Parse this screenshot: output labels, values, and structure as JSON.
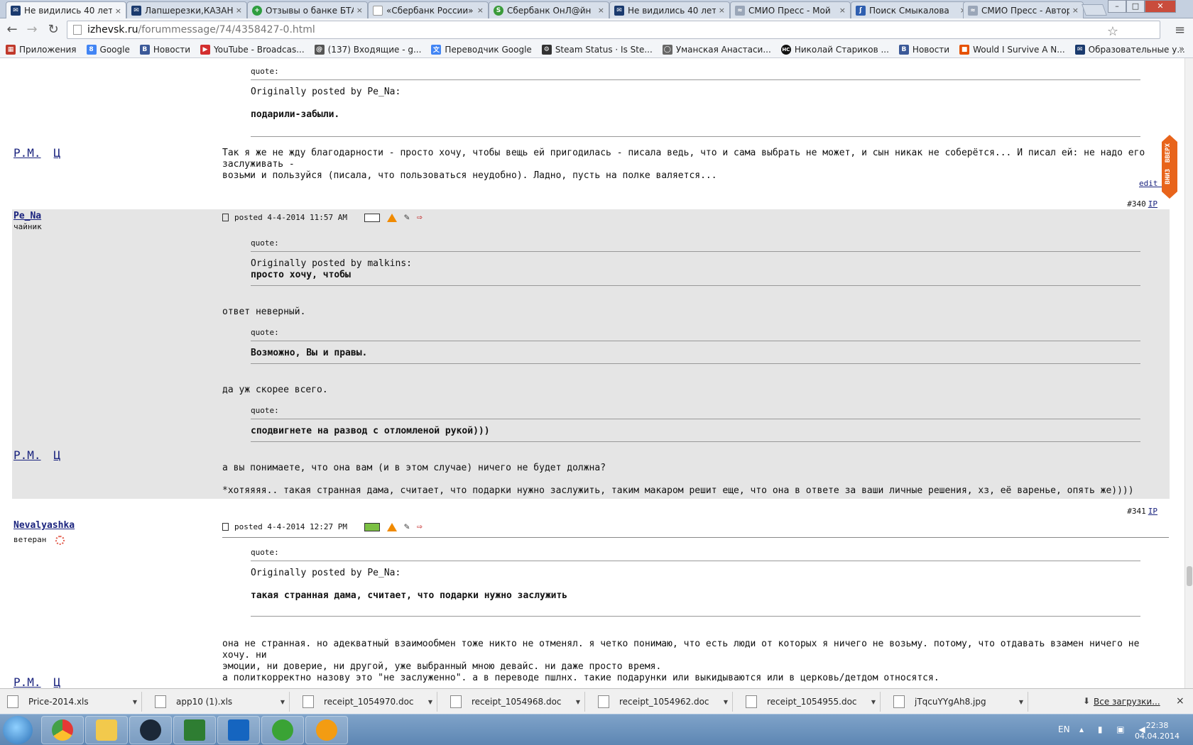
{
  "browser": {
    "tabs": [
      {
        "title": "Не видились 40 лет...",
        "color": "#1a3a6e",
        "fav": "✉"
      },
      {
        "title": "Лапшерезки,КАЗАНЬ",
        "color": "#1a3a6e",
        "fav": "✉"
      },
      {
        "title": "Отзывы о банке БТА",
        "color": "#2e9e3f",
        "fav": "+"
      },
      {
        "title": "«Сбербанк России»",
        "color": "#999999",
        "fav": ""
      },
      {
        "title": "Сбербанк ОнЛ@йн",
        "color": "#3a9b3a",
        "fav": "S"
      },
      {
        "title": "Не видились 40 лет...",
        "color": "#1a3a6e",
        "fav": "✉"
      },
      {
        "title": "СМИО Пресс - Мой",
        "color": "#9aa6b8",
        "fav": "≈"
      },
      {
        "title": "Поиск Смыкалова",
        "color": "#2f5fb0",
        "fav": "ʃ"
      },
      {
        "title": "СМИО Пресс - Автор",
        "color": "#9aa6b8",
        "fav": "≈"
      }
    ],
    "tab_close": "×",
    "window_buttons": [
      "–",
      "□",
      "✕"
    ],
    "back": "←",
    "forward": "→",
    "reload": "↻",
    "url_host": "izhevsk.ru",
    "url_path": "/forummessage/74/4358427-0.html",
    "star": "☆",
    "menu": "≡",
    "bookmarks": [
      {
        "label": "Приложения",
        "color": "#c0392b",
        "icon": "▦"
      },
      {
        "label": "Google",
        "color": "#4285f4",
        "icon": "8"
      },
      {
        "label": "Новости",
        "color": "#3b5998",
        "icon": "B"
      },
      {
        "label": "YouTube - Broadcas...",
        "color": "#d32f2f",
        "icon": "▶"
      },
      {
        "label": "(137) Входящие - g...",
        "color": "#555555",
        "icon": "@"
      },
      {
        "label": "Переводчик Google",
        "color": "#4285f4",
        "icon": "文"
      },
      {
        "label": "Steam Status · Is Ste...",
        "color": "#333333",
        "icon": "⚙"
      },
      {
        "label": "Уманская Анастаси...",
        "color": "#666666",
        "icon": "◯"
      },
      {
        "label": "Николай Стариков ...",
        "color": "#111111",
        "icon": "HC"
      },
      {
        "label": "Новости",
        "color": "#3b5998",
        "icon": "B"
      },
      {
        "label": "Would I Survive A N...",
        "color": "#e65100",
        "icon": "■"
      },
      {
        "label": "Образовательные у...",
        "color": "#1a3a6e",
        "icon": "✉"
      }
    ],
    "bookmarks_more": "»"
  },
  "forum": {
    "quote_label": "quote:",
    "float_up": "ВВЕРХ",
    "float_down": "ВНИЗ",
    "post1": {
      "quote_orig": "Originally posted by Pe_Na:",
      "quote_text": "подарили-забыли.",
      "rm": "Р.М.",
      "c": "Ц",
      "body_line1": "Так я же не жду благодарности - просто хочу, чтобы вещь ей пригодилась - писала ведь, что и сама выбрать не может, и сын никак не соберётся... И писал ей: не надо его заслуживать -",
      "body_line2": "возьми и пользуйся (писала, что пользоваться неудобно). Ладно, пусть на полке валяется...",
      "edit_log": "edit log",
      "num": "#340",
      "ip": "IP"
    },
    "post2": {
      "user": "Pe_Na",
      "rank": "чайник",
      "posted": "posted 4-4-2014 11:57 AM",
      "q1_orig": "Originally posted by malkins:",
      "q1_text": "просто хочу, чтобы",
      "body1": "ответ неверный.",
      "q2_text": "Возможно, Вы и правы.",
      "body2": "да уж скорее всего.",
      "q3_text": "сподвигнете на развод с отломленой рукой)))",
      "rm": "Р.М.",
      "c": "Ц",
      "body3": "а вы понимаете, что она вам (и в этом случае) ничего не будет должна?",
      "body4": "*хотяяяя.. такая странная дама, считает, что подарки нужно заслужить, таким макаром решит еще, что она в ответе за ваши личные решения, хз, её варенье, опять же))))",
      "num": "#341",
      "ip": "IP"
    },
    "post3": {
      "user": "Nevalyashka",
      "rank": "ветеран",
      "posted": "posted 4-4-2014 12:27 PM",
      "q_orig": "Originally posted by Pe_Na:",
      "q_text": "такая странная дама, считает, что подарки нужно заслужить",
      "body1": "она не странная. но адекватный взаимообмен тоже никто не отменял. я четко понимаю, что есть люди от которых я ничего не возьму. потому, что отдавать взамен ничего не хочу. ни",
      "body2": "эмоции, ни доверие, ни другой, уже выбранный мною девайс. ни даже просто время.",
      "body3": "а политкорректно назову это \"не заслуженно\". а в переводе пшлнх. такие подарунки или выкидываются или в церковь/детдом относятся.",
      "rm": "Р.М.",
      "c": "Ц"
    }
  },
  "downloads": {
    "items": [
      "Price-2014.xls",
      "app10 (1).xls",
      "receipt_1054970.doc",
      "receipt_1054968.doc",
      "receipt_1054962.doc",
      "receipt_1054955.doc",
      "jTqcuYYgAh8.jpg"
    ],
    "menu_arrow": "▼",
    "all_icon": "⬇",
    "all": "Все загрузки...",
    "close": "×"
  },
  "taskbar": {
    "apps": [
      {
        "name": "chrome",
        "color": "#e53935"
      },
      {
        "name": "explorer",
        "color": "#f2c94c"
      },
      {
        "name": "steam",
        "color": "#1b2838"
      },
      {
        "name": "excel",
        "color": "#2e7d32"
      },
      {
        "name": "search",
        "color": "#1565c0"
      },
      {
        "name": "utorrent",
        "color": "#3aa335"
      },
      {
        "name": "paint",
        "color": "#f39c12"
      }
    ],
    "lang": "EN",
    "tray": "▴ ▮ ▣ ◀",
    "time": "22:38",
    "date": "04.04.2014"
  }
}
